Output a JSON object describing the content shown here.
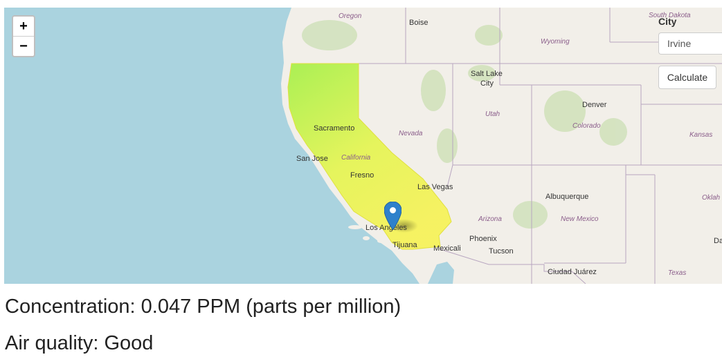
{
  "map": {
    "zoom_in": "+",
    "zoom_out": "−",
    "marker_icon": "map-pin-icon",
    "state_labels": {
      "oregon": "Oregon",
      "south_dakota": "South Dakota",
      "wyoming": "Wyoming",
      "nevada": "Nevada",
      "utah": "Utah",
      "colorado": "Colorado",
      "kansas": "Kansas",
      "california": "California",
      "arizona": "Arizona",
      "new_mexico": "New Mexico",
      "oklahoma": "Oklah",
      "texas": "Texas"
    },
    "city_labels": {
      "boise": "Boise",
      "salt_lake_city_1": "Salt Lake",
      "salt_lake_city_2": "City",
      "denver": "Denver",
      "sacramento": "Sacramento",
      "san_jose": "San Jose",
      "fresno": "Fresno",
      "las_vegas": "Las Vegas",
      "albuquerque": "Albuquerque",
      "los_angeles": "Los Angeles",
      "tijuana": "Tijuana",
      "mexicali": "Mexicali",
      "phoenix": "Phoenix",
      "tucson": "Tucson",
      "ciudad_juarez": "Ciudad Juárez",
      "dallas": "Da"
    },
    "colors": {
      "water": "#aad3df",
      "land": "#f2efe9",
      "california_fill_north": "#9ef03a",
      "california_fill_south": "#f3f545"
    }
  },
  "controls": {
    "city_label": "City",
    "city_value": "Irvine",
    "calculate_label": "Calculate"
  },
  "results": {
    "concentration": "Concentration: 0.047 PPM (parts per million)",
    "air_quality": "Air quality: Good"
  }
}
